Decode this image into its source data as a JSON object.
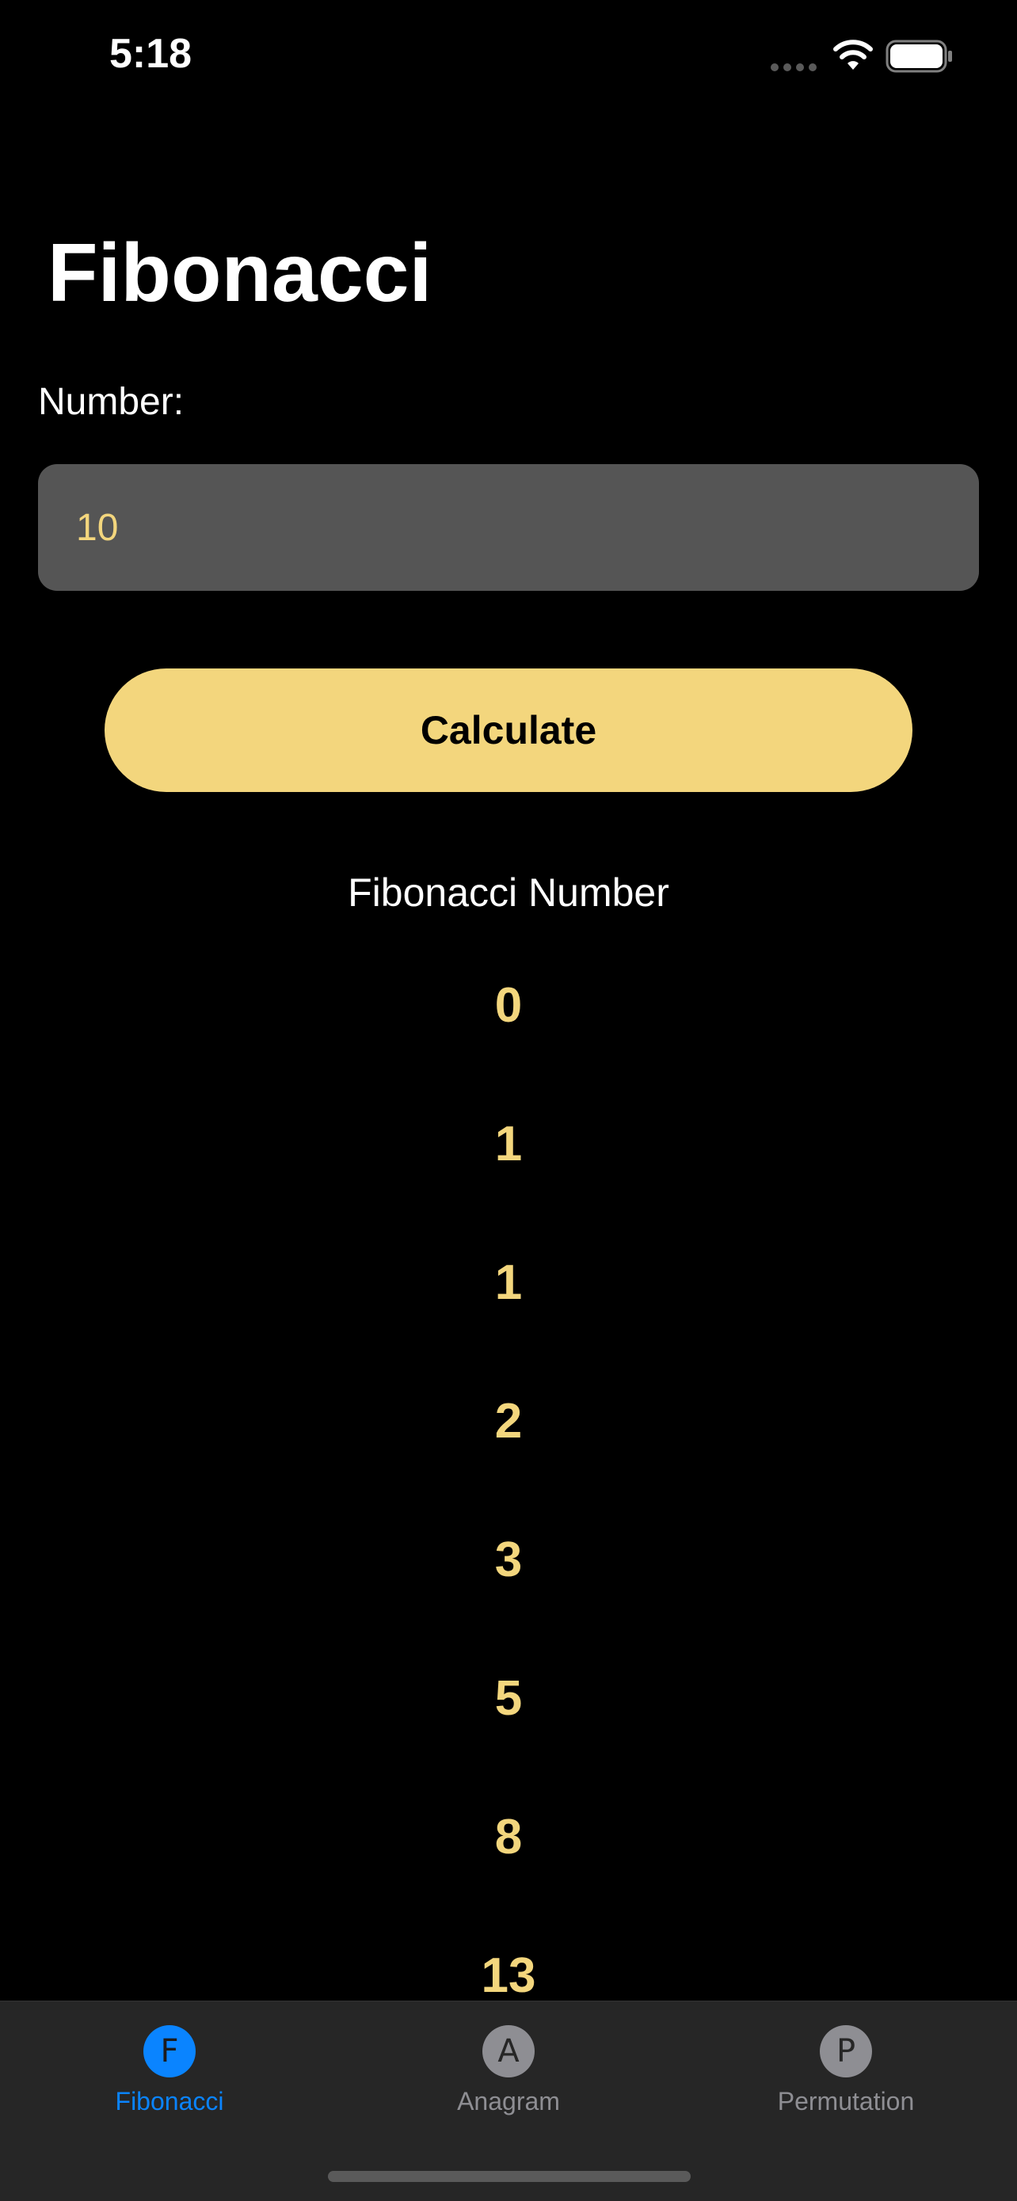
{
  "status_bar": {
    "time": "5:18",
    "signal_icon": "cellular-dots-icon",
    "wifi_icon": "wifi-icon",
    "battery_icon": "battery-full-icon"
  },
  "header": {
    "title": "Fibonacci"
  },
  "form": {
    "number_label": "Number:",
    "number_value": "10",
    "calculate_label": "Calculate"
  },
  "results": {
    "heading": "Fibonacci Number",
    "values": [
      "0",
      "1",
      "1",
      "2",
      "3",
      "5",
      "8",
      "13"
    ]
  },
  "tab_bar": {
    "tabs": [
      {
        "label": "Fibonacci",
        "icon_letter": "F",
        "active": true
      },
      {
        "label": "Anagram",
        "icon_letter": "A",
        "active": false
      },
      {
        "label": "Permutation",
        "icon_letter": "P",
        "active": false
      }
    ]
  },
  "colors": {
    "accent": "#f3d67d",
    "tab_active": "#0a84ff",
    "tab_inactive": "#8e8e93",
    "input_background": "#555555",
    "background": "#000000"
  }
}
